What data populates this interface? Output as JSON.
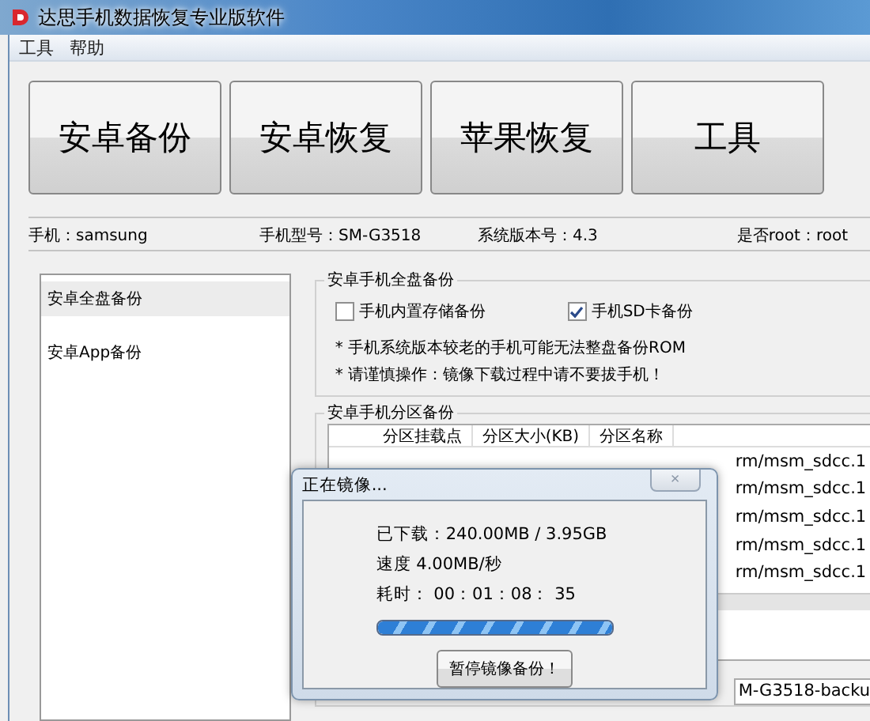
{
  "window": {
    "title": "达思手机数据恢复专业版软件"
  },
  "menu": [
    "工具",
    "帮助"
  ],
  "main_buttons": [
    "安卓备份",
    "安卓恢复",
    "苹果恢复",
    "工具"
  ],
  "device_info": [
    "手机：samsung",
    "手机型号：SM-G3518",
    "系统版本号：4.3",
    "是否root：root"
  ],
  "sidebar": {
    "items": [
      {
        "label": "安卓全盘备份",
        "selected": true
      },
      {
        "label": "安卓App备份",
        "selected": false
      }
    ]
  },
  "full_backup": {
    "title": "安卓手机全盘备份",
    "options": [
      {
        "label": "手机内置存储备份",
        "checked": false
      },
      {
        "label": "手机SD卡备份",
        "checked": true
      }
    ],
    "notes": [
      "* 手机系统版本较老的手机可能无法整盘备份ROM",
      "* 请谨慎操作：镜像下载过程中请不要拔手机！"
    ]
  },
  "partition_backup": {
    "title": "安卓手机分区备份",
    "table": {
      "columns": [
        "分区挂载点",
        "分区大小(KB)",
        "分区名称"
      ],
      "rows": [
        "rm/msm_sdcc.1",
        "rm/msm_sdcc.1",
        "rm/msm_sdcc.1",
        "rm/msm_sdcc.1",
        "rm/msm_sdcc.1"
      ]
    },
    "path": "M-G3518-backu"
  },
  "dialog": {
    "title": "正在镜像...",
    "close": "×",
    "downloaded": "已下载：240.00MB / 3.95GB",
    "speed": "速度 4.00MB/秒",
    "elapsed": "耗时： 00：01：08： 35",
    "level": 1.0,
    "button": "暂停镜像备份！"
  }
}
